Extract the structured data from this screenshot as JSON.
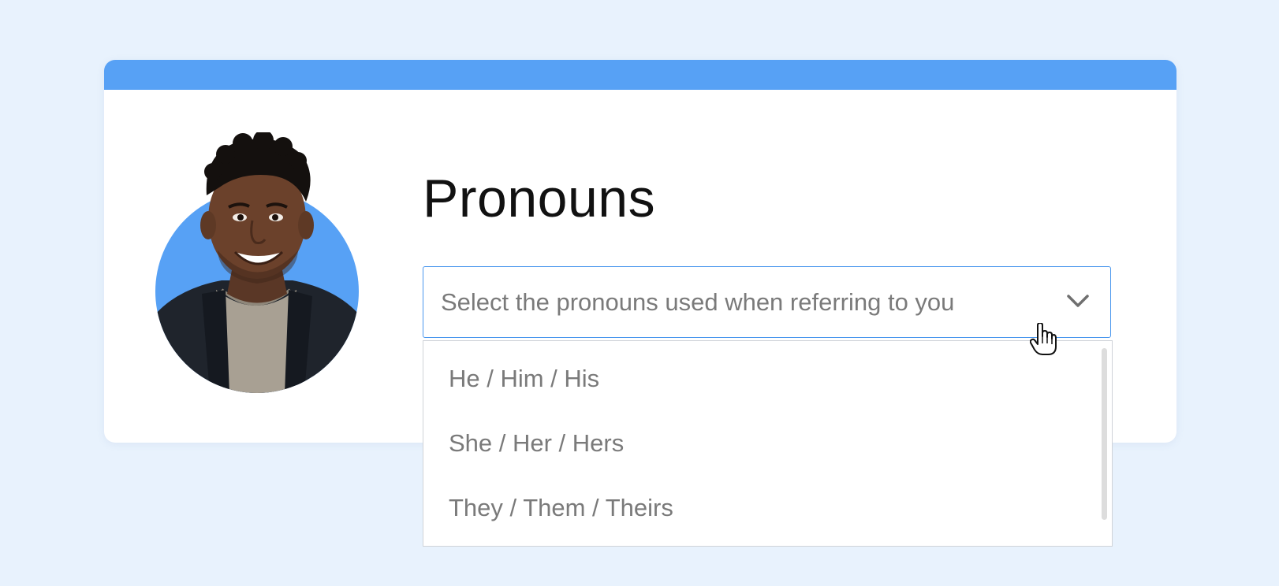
{
  "card": {
    "title": "Pronouns"
  },
  "pronoun_select": {
    "placeholder": "Select the pronouns used when referring to you",
    "options": [
      "He / Him / His",
      "She / Her / Hers",
      "They / Them / Theirs"
    ],
    "expanded": true
  },
  "icons": {
    "dropdown_toggle": "chevron-down-icon",
    "pointer": "hand-pointer-icon"
  },
  "colors": {
    "background": "#e8f2fd",
    "accent": "#57a1f5",
    "select_border": "#4a97ee",
    "option_text": "#7a7a7a",
    "title_text": "#111111"
  }
}
